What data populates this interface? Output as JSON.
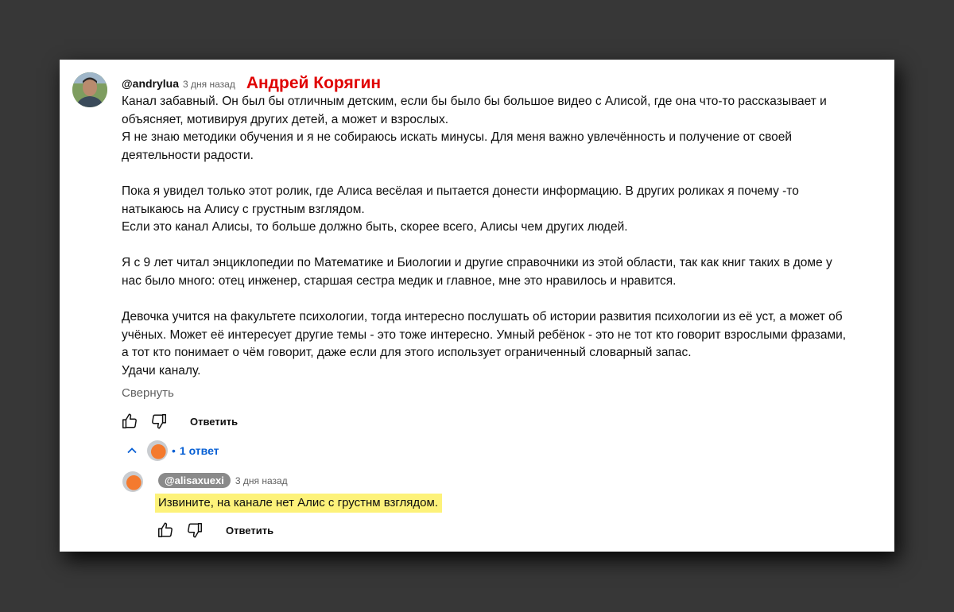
{
  "comment": {
    "author": "@andrylua",
    "time": "3 дня назад",
    "annotation": "Андрей Корягин",
    "lines": [
      "Канал забавный. Он был бы отличным детским, если бы было бы большое видео с Алисой, где она что-то рассказывает и",
      "объясняет, мотивируя других детей, а может и взрослых.",
      "Я не знаю методики обучения и я не собираюсь искать минусы. Для меня важно увлечённость и получение от своей",
      "деятельности радости.",
      "",
      "Пока я увидел только этот ролик, где Алиса весёлая и пытается донести информацию. В других роликах я почему -то",
      "натыкаюсь на Алису с грустным взглядом.",
      "Если это канал Алисы, то больше должно быть, скорее всего, Алисы чем других людей.",
      "",
      "Я с 9 лет читал энциклопедии по Математике и Биологии и другие справочники из этой области, так как книг таких в доме у",
      "нас было много: отец инженер, старшая сестра медик и главное, мне это нравилось и нравится.",
      "",
      "Девочка учится на факультете психологии, тогда интересно послушать об истории развития психологии из её уст, а может об",
      "учёных. Может её интересует другие темы - это тоже интересно. Умный ребёнок - это не тот кто говорит взрослыми фразами,",
      "а тот кто понимает о чём говорит, даже если для этого использует ограниченный словарный запас.",
      "Удачи каналу."
    ],
    "collapse_label": "Свернуть",
    "reply_label": "Ответить"
  },
  "replies_toggle": {
    "dot": "•",
    "count_label": "1 ответ"
  },
  "reply": {
    "author": "@alisaxuexi",
    "time": "3 дня назад",
    "text": "Извините, на канале нет Алис с грустнм взглядом.",
    "reply_label": "Ответить"
  },
  "colors": {
    "annotation": "#e00000",
    "highlight": "#fdf27a",
    "link": "#065fd4"
  }
}
